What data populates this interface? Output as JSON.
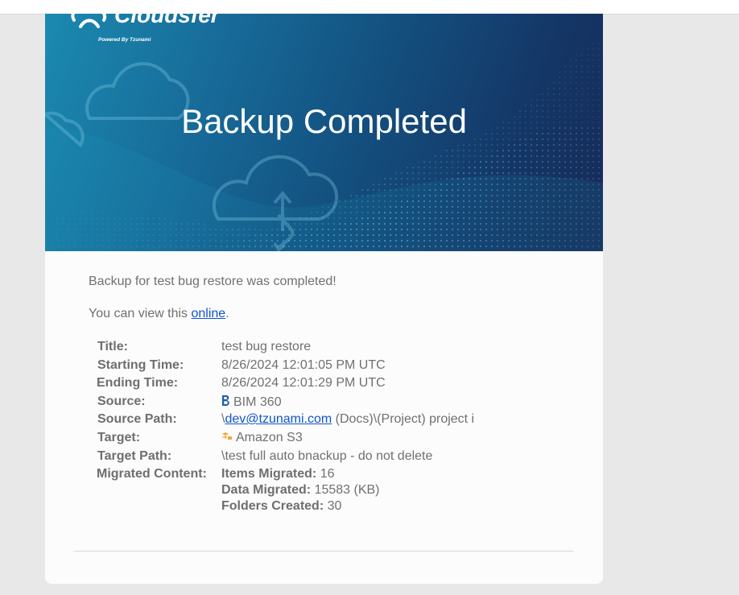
{
  "logo": {
    "brand": "Cloudsfer",
    "tagline": "Powered By Tzunami"
  },
  "banner": {
    "title": "Backup Completed"
  },
  "message": {
    "completed_text": "Backup for test bug restore was completed!",
    "view_prefix": "You can view this ",
    "view_link": "online",
    "view_suffix": "."
  },
  "details": {
    "title": {
      "label": "Title:",
      "value": "test bug restore"
    },
    "starting_time": {
      "label": "Starting Time:",
      "value": "8/26/2024 12:01:05 PM UTC"
    },
    "ending_time": {
      "label": "Ending Time:",
      "value": "8/26/2024 12:01:29 PM UTC"
    },
    "source": {
      "label": "Source:",
      "value": "BIM 360",
      "icon": "bim360-icon"
    },
    "source_path": {
      "label": "Source Path:",
      "prefix": "\\",
      "link": "dev@tzunami.com",
      "rest": " (Docs)\\(Project) project i"
    },
    "target": {
      "label": "Target:",
      "value": "Amazon S3",
      "icon": "amazon-s3-icon"
    },
    "target_path": {
      "label": "Target Path:",
      "value": "\\test full auto bnackup - do not delete"
    },
    "migrated_content": {
      "label": "Migrated Content:",
      "items_label": "Items Migrated:",
      "items_value": " 16",
      "data_label": "Data Migrated:",
      "data_value": " 15583 (KB)",
      "folders_label": "Folders Created:",
      "folders_value": " 30"
    }
  },
  "colors": {
    "link": "#1155cc",
    "text": "#707070",
    "banner_dark": "#172a57",
    "banner_light": "#1b8ab0",
    "page_bg": "#e8e8e8"
  }
}
